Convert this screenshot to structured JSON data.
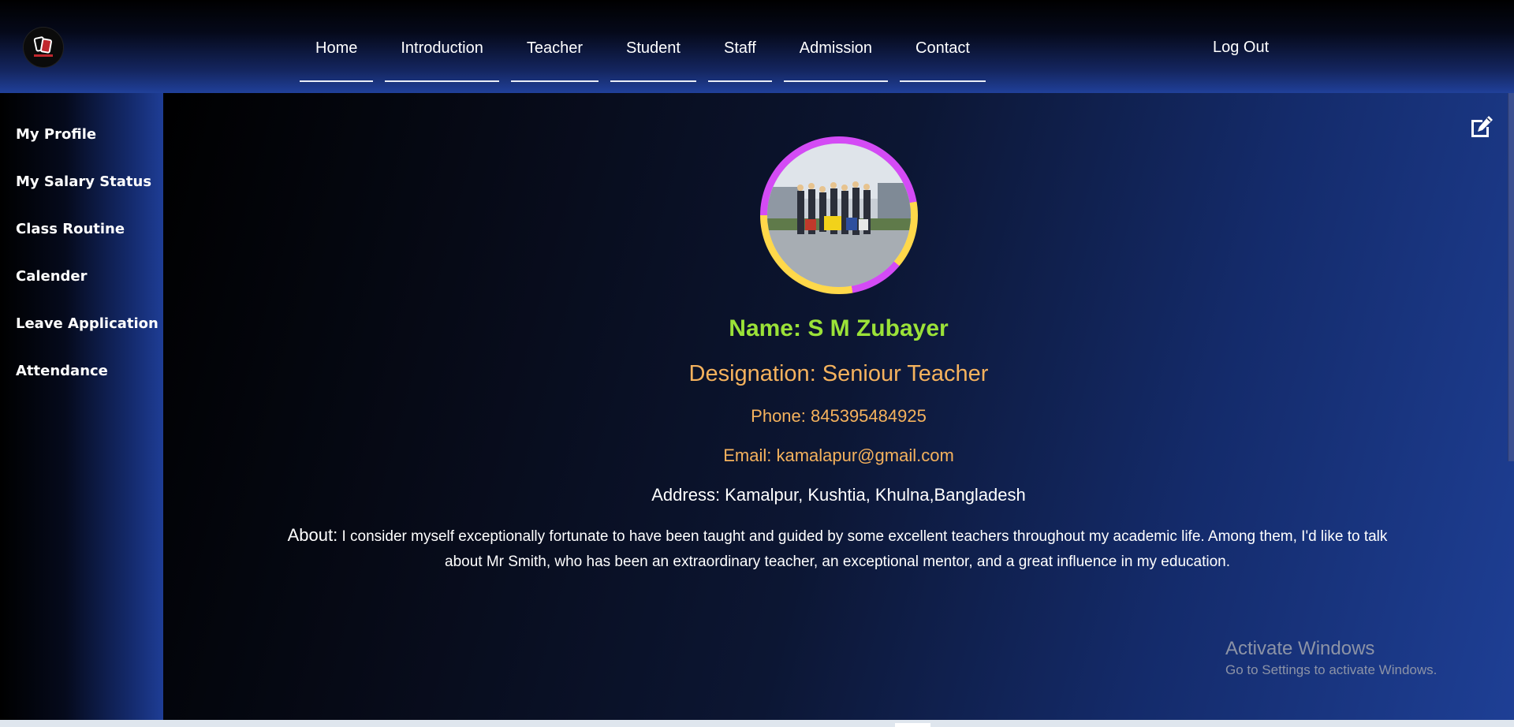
{
  "nav": {
    "items": [
      {
        "label": "Home"
      },
      {
        "label": "Introduction"
      },
      {
        "label": "Teacher"
      },
      {
        "label": "Student"
      },
      {
        "label": "Staff"
      },
      {
        "label": "Admission"
      },
      {
        "label": "Contact"
      }
    ],
    "logout_label": "Log Out"
  },
  "sidebar": {
    "items": [
      {
        "label": "My Profile"
      },
      {
        "label": "My Salary Status"
      },
      {
        "label": "Class Routine"
      },
      {
        "label": "Calender"
      },
      {
        "label": "Leave Application"
      },
      {
        "label": "Attendance"
      }
    ]
  },
  "profile": {
    "name": "Name: S M Zubayer",
    "designation": "Designation: Seniour Teacher",
    "phone": "Phone: 845395484925",
    "email": "Email: kamalapur@gmail.com",
    "address": "Address: Kamalpur, Kushtia, Khulna,Bangladesh",
    "about_label": "About:",
    "about_text": " I consider myself exceptionally fortunate to have been taught and guided by some excellent teachers throughout my academic life. Among them, I'd like to talk about Mr Smith, who has been an extraordinary teacher, an exceptional mentor, and a great influence in my education."
  },
  "windows_watermark": {
    "title": "Activate Windows",
    "subtitle": "Go to Settings to activate Windows."
  },
  "icons": {
    "edit": "edit-icon",
    "logo": "logo-icon"
  },
  "colors": {
    "name": "#9be238",
    "details": "#f5b25d",
    "avatar_ring_a": "#d44bf5",
    "avatar_ring_b": "#ffd84a"
  }
}
